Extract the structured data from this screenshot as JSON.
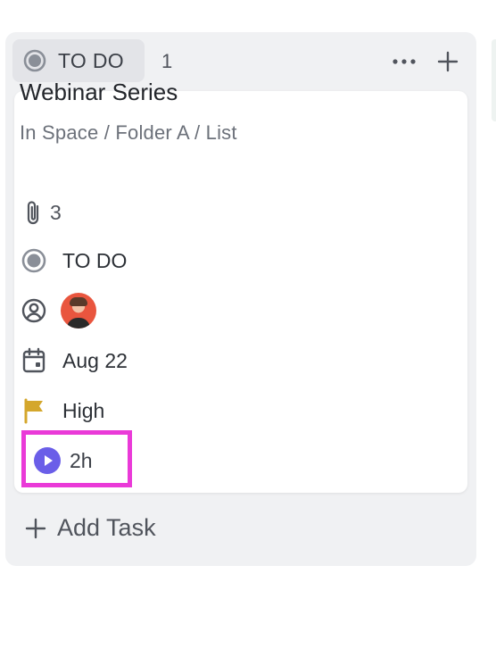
{
  "column": {
    "status_label": "TO DO",
    "task_count": "1",
    "status_color": "#8a8f98"
  },
  "card": {
    "title": "Webinar Series",
    "path": "In Space / Folder A / List",
    "attachments_count": "3",
    "status": "TO DO",
    "due_date": "Aug 22",
    "priority": "High",
    "priority_color": "#d4a72c",
    "time_tracked": "2h",
    "timer_color": "#6a5ee8"
  },
  "footer": {
    "add_task_label": "Add Task"
  },
  "icons": [
    "status-circle-icon",
    "more-icon",
    "plus-icon",
    "paperclip-icon",
    "assignee-icon",
    "calendar-icon",
    "flag-icon",
    "play-icon"
  ]
}
